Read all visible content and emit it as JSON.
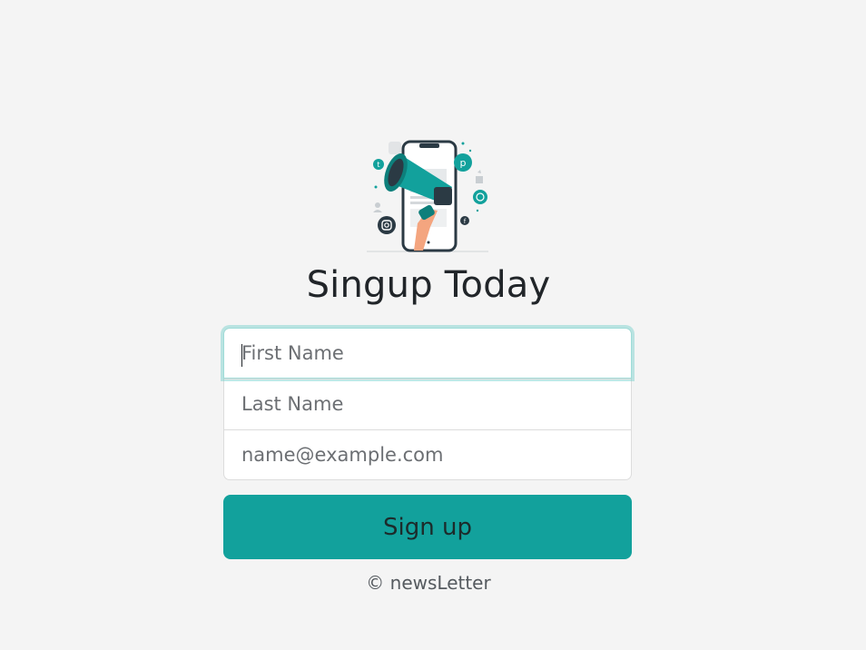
{
  "hero": {
    "icon": "megaphone-phone-illustration",
    "accent_color": "#12a19c"
  },
  "title": "Singup Today",
  "form": {
    "first_name_placeholder": "First Name",
    "last_name_placeholder": "Last Name",
    "email_placeholder": "name@example.com",
    "submit_label": "Sign up"
  },
  "footer": {
    "text": "© newsLetter"
  }
}
